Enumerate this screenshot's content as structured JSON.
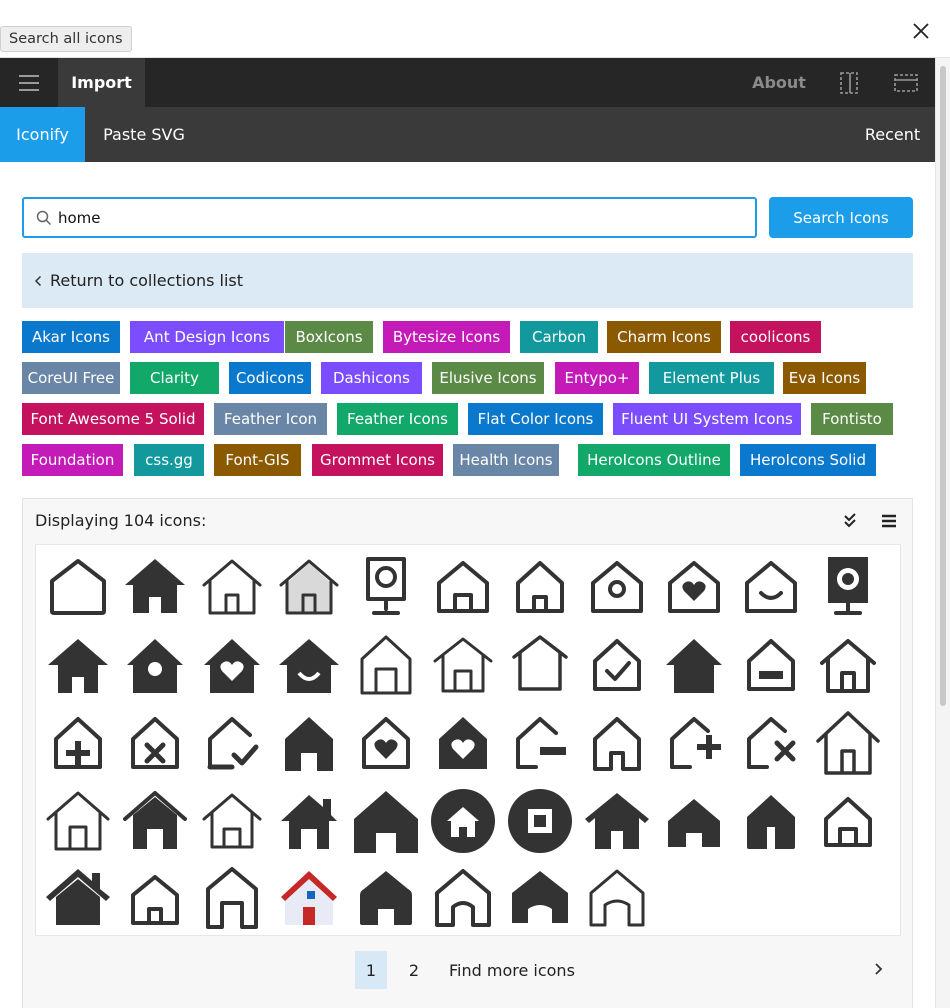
{
  "tooltip": "Search all icons",
  "nav": {
    "import_label": "Import",
    "about_label": "About"
  },
  "subnav": {
    "iconify_label": "Iconify",
    "paste_label": "Paste SVG",
    "recent_label": "Recent"
  },
  "search": {
    "value": "home",
    "button_label": "Search Icons"
  },
  "return_label": "Return to collections list",
  "collections": [
    {
      "label": "Akar Icons",
      "color": "#0a78cc"
    },
    {
      "label": "Ant Design Icons",
      "color": "#7c4dff"
    },
    {
      "label": "BoxIcons",
      "color": "#5a8a45"
    },
    {
      "label": "Bytesize Icons",
      "color": "#c41ab8"
    },
    {
      "label": "Carbon",
      "color": "#11999e"
    },
    {
      "label": "Charm Icons",
      "color": "#8b5a00"
    },
    {
      "label": "coolicons",
      "color": "#c4125e"
    },
    {
      "label": "CoreUI Free",
      "color": "#6a86a6"
    },
    {
      "label": "Clarity",
      "color": "#11a86a"
    },
    {
      "label": "Codicons",
      "color": "#0a78cc"
    },
    {
      "label": "Dashicons",
      "color": "#7c4dff"
    },
    {
      "label": "Elusive Icons",
      "color": "#5a8a45"
    },
    {
      "label": "Entypo+",
      "color": "#c41ab8"
    },
    {
      "label": "Element Plus",
      "color": "#11999e"
    },
    {
      "label": "Eva Icons",
      "color": "#8b5a00"
    },
    {
      "label": "Font Awesome 5 Solid",
      "color": "#c4125e"
    },
    {
      "label": "Feather Icon",
      "color": "#6a86a6"
    },
    {
      "label": "Feather Icons",
      "color": "#11a86a"
    },
    {
      "label": "Flat Color Icons",
      "color": "#0a78cc"
    },
    {
      "label": "Fluent UI System Icons",
      "color": "#7c4dff"
    },
    {
      "label": "Fontisto",
      "color": "#5a8a45"
    },
    {
      "label": "Foundation",
      "color": "#c41ab8"
    },
    {
      "label": "css.gg",
      "color": "#11999e"
    },
    {
      "label": "Font-GIS",
      "color": "#8b5a00"
    },
    {
      "label": "Grommet Icons",
      "color": "#c4125e"
    },
    {
      "label": "Health Icons",
      "color": "#6a86a6"
    },
    {
      "label": "HeroIcons Outline",
      "color": "#11a86a"
    },
    {
      "label": "HeroIcons Solid",
      "color": "#0a78cc"
    }
  ],
  "results": {
    "header": "Displaying 104 icons:"
  },
  "icons": [
    "home-outline-icon",
    "home-solid-icon",
    "home-door-outline-icon",
    "home-gray-filled-icon",
    "webcam-outline-icon",
    "home-line-icon",
    "home-rounded-outline-icon",
    "home-circle-window-icon",
    "home-heart-outline-icon",
    "home-smile-outline-icon",
    "webcam-solid-icon",
    "home-solid-2-icon",
    "home-solid-circle-icon",
    "home-heart-solid-icon",
    "home-smile-solid-icon",
    "home-thin-outline-icon",
    "home-thin-door-icon",
    "home-rounded-thin-icon",
    "home-check-icon",
    "home-solid-3-icon",
    "home-minus-icon",
    "home-outline-2-icon",
    "home-plus-icon",
    "home-x-icon",
    "home-check-partial-icon",
    "home-solid-arch-icon",
    "home-heart-outline-2-icon",
    "home-heart-solid-2-icon",
    "home-minus-partial-icon",
    "home-simple-outline-icon",
    "home-plus-partial-icon",
    "home-x-partial-icon",
    "home-large-outline-icon",
    "home-roof-outline-icon",
    "home-roof-solid-icon",
    "home-roof-thin-icon",
    "home-chimney-icon",
    "home-big-solid-icon",
    "home-circle-solid-icon",
    "home-circle-square-icon",
    "home-fa-solid-icon",
    "home-flat-solid-icon",
    "home-door-solid-icon",
    "home-door-rounded-icon",
    "home-chimney-solid-icon",
    "home-small-outline-icon",
    "home-tall-outline-icon",
    "home-flat-color-icon",
    "home-rounded-solid-icon",
    "home-arch-outline-icon",
    "home-arch-solid-icon",
    "home-arch-thin-icon"
  ],
  "pagination": {
    "page1": "1",
    "page2": "2",
    "find_more": "Find more icons"
  }
}
